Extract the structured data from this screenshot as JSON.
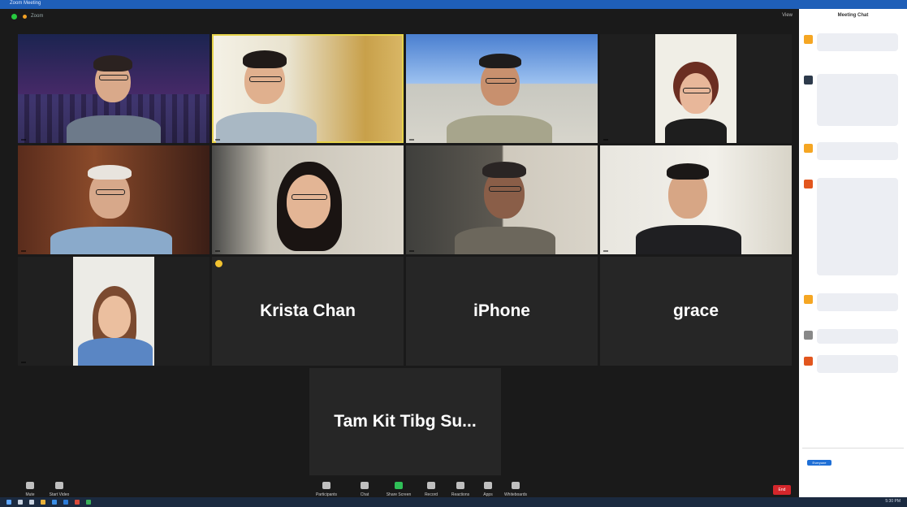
{
  "window": {
    "title": "Zoom Meeting"
  },
  "topbar": {
    "info": "Zoom",
    "view": "View"
  },
  "tiles": [
    {
      "name": "",
      "type": "video"
    },
    {
      "name": "",
      "type": "video"
    },
    {
      "name": "",
      "type": "video"
    },
    {
      "name": "",
      "type": "video"
    },
    {
      "name": "",
      "type": "video"
    },
    {
      "name": "",
      "type": "video"
    },
    {
      "name": "",
      "type": "video"
    },
    {
      "name": "",
      "type": "video"
    },
    {
      "name": "",
      "type": "video"
    },
    {
      "name": "Krista Chan",
      "type": "name"
    },
    {
      "name": "iPhone",
      "type": "name"
    },
    {
      "name": "grace",
      "type": "name"
    },
    {
      "name": "Tam Kit Tibg Su...",
      "type": "name"
    }
  ],
  "toolbar": {
    "mute": "Mute",
    "video": "Start Video",
    "participants": "Participants",
    "chat": "Chat",
    "share": "Share Screen",
    "record": "Record",
    "reactions": "Reactions",
    "apps": "Apps",
    "whiteboards": "Whiteboards",
    "end": "End"
  },
  "chat": {
    "title": "Meeting Chat",
    "input_to": "Everyone",
    "colors": [
      "#f5a623",
      "#2d3a4b",
      "#f5a623",
      "#e2561e",
      "#f5a623",
      "#888888",
      "#e2561e"
    ]
  },
  "taskbar": {
    "clock": "5:30 PM"
  }
}
